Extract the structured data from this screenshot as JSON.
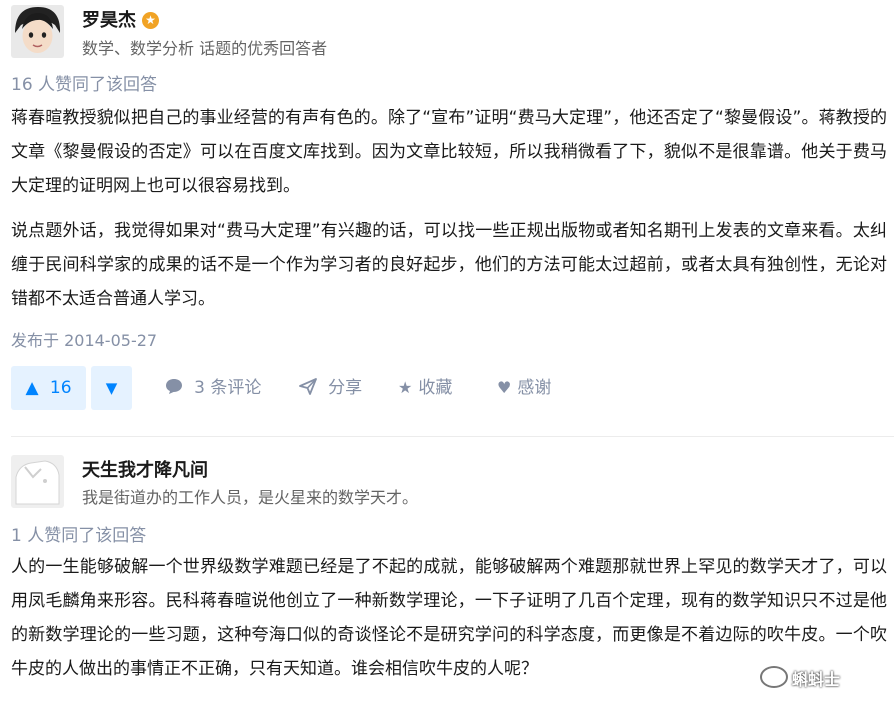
{
  "answer1": {
    "author_name": "罗昊杰",
    "badge_icon": "star-badge-icon",
    "author_bio": "数学、数学分析 话题的优秀回答者",
    "votes_line": "16 人赞同了该回答",
    "paragraphs": [
      "蒋春暄教授貌似把自己的事业经营的有声有色的。除了“宣布”证明“费马大定理”，他还否定了“黎曼假设”。蒋教授的文章《黎曼假设的否定》可以在百度文库找到。因为文章比较短，所以我稍微看了下，貌似不是很靠谱。他关于费马大定理的证明网上也可以很容易找到。",
      "说点题外话，我觉得如果对“费马大定理”有兴趣的话，可以找一些正规出版物或者知名期刊上发表的文章来看。太纠缠于民间科学家的成果的话不是一个作为学习者的良好起步，他们的方法可能太过超前，或者太具有独创性，无论对错都不太适合普通人学习。"
    ],
    "published": "发布于 2014-05-27",
    "actions": {
      "upvote_count": "16",
      "comments": "3 条评论",
      "share": "分享",
      "collect": "收藏",
      "thanks": "感谢"
    }
  },
  "answer2": {
    "author_name": "天生我才降凡间",
    "author_bio": "我是街道办的工作人员，是火星来的数学天才。",
    "votes_line": "1 人赞同了该回答",
    "paragraphs": [
      "人的一生能够破解一个世界级数学难题已经是了不起的成就，能够破解两个难题那就世界上罕见的数学天才了，可以用凤毛麟角来形容。民科蒋春暄说他创立了一种新数学理论，一下子证明了几百个定理，现有的数学知识只不过是他的新数学理论的一些习题，这种夸海口似的奇谈怪论不是研究学问的科学态度，而更像是不着边际的吹牛皮。一个吹牛皮的人做出的事情正不正确，只有天知道。谁会相信吹牛皮的人呢？"
    ]
  },
  "watermark": "蝌蚪士",
  "colors": {
    "accent": "#0084ff",
    "accent_bg": "#e5f2ff",
    "meta_gray": "#8590a6",
    "badge": "#f1a325"
  }
}
